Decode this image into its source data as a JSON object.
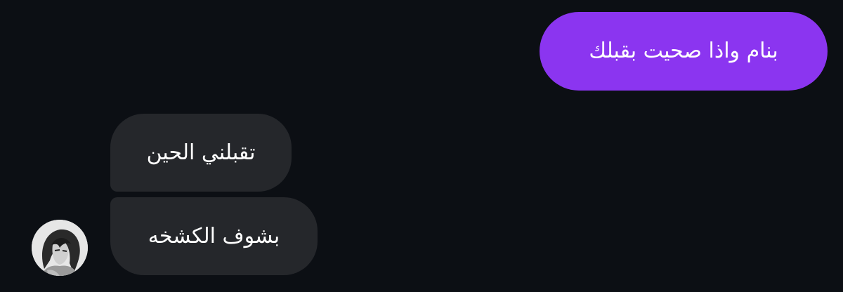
{
  "messages": {
    "sent": [
      {
        "text": "بنام واذا صحيت بقبلك"
      }
    ],
    "received": [
      {
        "text": "تقبلني الحين"
      },
      {
        "text": "بشوف الكشخه"
      }
    ]
  },
  "contact": {
    "avatar_icon": "anime-character-avatar"
  },
  "colors": {
    "background": "#0c0f14",
    "sent_bubble": "#8b35f0",
    "received_bubble": "#25272b",
    "text": "#ffffff"
  }
}
